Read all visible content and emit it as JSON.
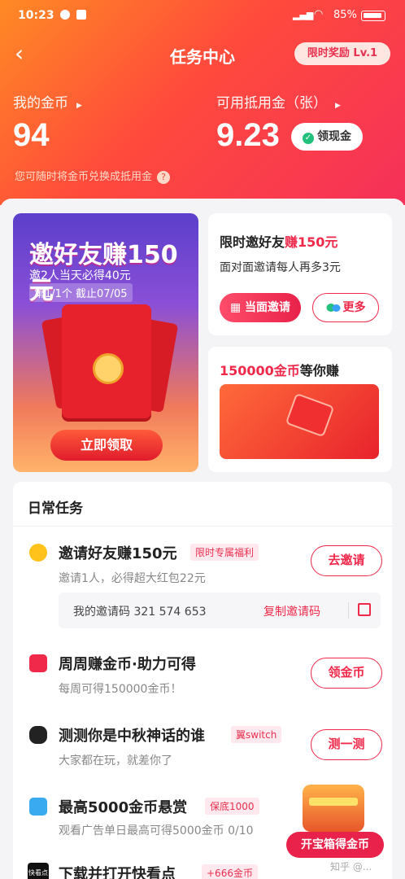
{
  "status": {
    "time": "10:23",
    "battery": "85%"
  },
  "header": {
    "title": "任务中心",
    "level_badge": "限时奖励 Lv.1",
    "coins_label": "我的金币",
    "coins_value": "94",
    "voucher_label": "可用抵用金（张）",
    "voucher_value": "9.23",
    "cash_button": "领现金",
    "hint": "您可随时将金币兑换成抵用金"
  },
  "promo": {
    "big_title": "邀好友赚150元",
    "big_sub": "邀2人当天必得40元",
    "big_sub2": "第1/1个 截止07/05",
    "claim_button": "立即领取",
    "invite_title_a": "限时邀好友",
    "invite_title_b": "赚150元",
    "invite_sub": "面对面邀请每人再多3元",
    "f2f_button": "当面邀请",
    "more_button": "更多",
    "coin_title_a": "150000金币",
    "coin_title_b": "等你赚"
  },
  "daily": {
    "header": "日常任务",
    "tasks": [
      {
        "title": "邀请好友赚150元",
        "tag": "限时专属福利",
        "sub": "邀请1人，必得超大红包22元",
        "action": "去邀请"
      },
      {
        "title": "周周赚金币·助力可得",
        "tag": "",
        "sub": "每周可得150000金币！",
        "action": "领金币"
      },
      {
        "title": "测测你是中秋神话的谁",
        "tag": "翼switch",
        "sub": "大家都在玩，就差你了",
        "action": "测一测"
      },
      {
        "title": "最高5000金币悬赏",
        "tag": "保底1000",
        "sub": "观看广告单日最高可得5000金币 0/10",
        "action": ""
      }
    ],
    "code_label": "我的邀请码 321 574 653",
    "code_copy": "复制邀请码",
    "last_title": "下载并打开快看点",
    "last_tag": "+666金币",
    "last_icon": "快看点"
  },
  "chest_button": "开宝箱得金币",
  "watermark": "知乎 @...",
  "colors": {
    "accent": "#f0284a",
    "header_start": "#ff8a24",
    "header_end": "#f5305a"
  }
}
